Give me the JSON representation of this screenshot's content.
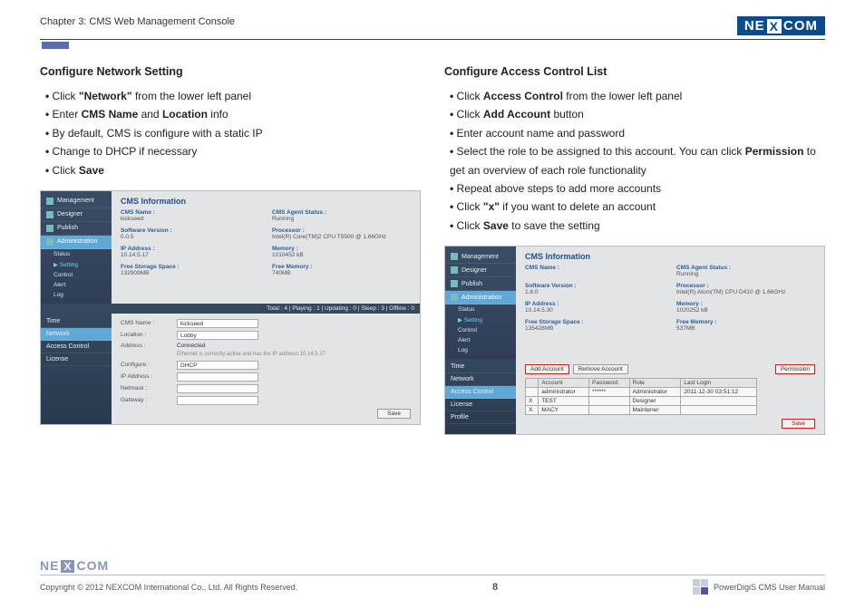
{
  "header": {
    "chapter": "Chapter 3: CMS Web Management Console",
    "logo_left": "NE",
    "logo_x": "X",
    "logo_right": "COM"
  },
  "left": {
    "title": "Configure Network Setting",
    "bullets": [
      "Click <b>\"Network\"</b> from the lower left panel",
      "Enter <b>CMS Name</b> and <b>Location</b> info",
      "By default, CMS is configure with a static IP",
      "Change to DHCP if necessary",
      "Click <b>Save</b>"
    ],
    "ss": {
      "side": [
        "Management",
        "Designer",
        "Publish",
        "Administration"
      ],
      "subs": [
        "Status",
        "▶ Setting",
        "Control",
        "Alert",
        "Log"
      ],
      "title": "CMS Information",
      "info": [
        {
          "lbl": "CMS Name :",
          "val": "kickseed"
        },
        {
          "lbl": "CMS Agent Status :",
          "val": "Running"
        },
        {
          "lbl": "Software Version :",
          "val": "0.0.5"
        },
        {
          "lbl": "Processor :",
          "val": "Intel(R) Core(TM)2 CPU T5500 @ 1.66GHz"
        },
        {
          "lbl": "IP Address :",
          "val": "10.14.5.17"
        },
        {
          "lbl": "Memory :",
          "val": "1010452 kB"
        },
        {
          "lbl": "Free Storage Space :",
          "val": "132909MB"
        },
        {
          "lbl": "Free Memory :",
          "val": "740MB"
        }
      ],
      "status": "Total : 4  |  Playing : 1  |  Updating : 0  |  Sleep : 3  |  Offline : 0",
      "lower_side": [
        "Time",
        "Network",
        "Access Control",
        "License"
      ],
      "form": {
        "cms_name_label": "CMS Name :",
        "cms_name_val": "kickseed",
        "location_label": "Location :",
        "location_val": "Lobby",
        "address_label": "Address :",
        "address_val": "Connected",
        "eth_note": "Ethernet is currently active and has the IP address 10.14.5.17",
        "configure_label": "Configure :",
        "configure_val": "DHCP",
        "ip_label": "IP Address :",
        "netmask_label": "Netmask :",
        "gateway_label": "Gateway :",
        "save": "Save"
      }
    }
  },
  "right": {
    "title": "Configure Access Control List",
    "bullets": [
      "Click <b>Access Control</b> from the lower left panel",
      "Click <b>Add Account</b> button",
      "Enter account name and password",
      "Select the role to be assigned to this account. You can click <b>Permission</b> to get an overview of each role functionality",
      "Repeat above steps to add more accounts",
      "Click <b>\"x\"</b> if you want to delete an account",
      "Click <b>Save</b> to save the setting"
    ],
    "ss": {
      "side": [
        "Management",
        "Designer",
        "Publish",
        "Administration"
      ],
      "subs": [
        "Status",
        "▶ Setting",
        "Control",
        "Alert",
        "Log"
      ],
      "title": "CMS Information",
      "info": [
        {
          "lbl": "CMS Name :",
          "val": ""
        },
        {
          "lbl": "CMS Agent Status :",
          "val": "Running"
        },
        {
          "lbl": "Software Version :",
          "val": "1.8.0"
        },
        {
          "lbl": "Processor :",
          "val": "Intel(R) Atom(TM) CPU D410 @ 1.66GHz"
        },
        {
          "lbl": "IP Address :",
          "val": "10.14.5.30"
        },
        {
          "lbl": "Memory :",
          "val": "1020252 kB"
        },
        {
          "lbl": "Free Storage Space :",
          "val": "135428MB"
        },
        {
          "lbl": "Free Memory :",
          "val": "537MB"
        }
      ],
      "lower_side": [
        "Time",
        "Network",
        "Access Control",
        "License",
        "Profile"
      ],
      "buttons": {
        "add": "Add Account",
        "remove": "Remove Account",
        "perm": "Permission"
      },
      "table": {
        "headers": [
          "",
          "Account",
          "Password",
          "Role",
          "Last Login"
        ],
        "rows": [
          [
            "",
            "administrator",
            "******",
            "Administrator",
            "2011-12-30 03:51:12"
          ],
          [
            "X",
            "TEST",
            "",
            "Designer",
            ""
          ],
          [
            "X",
            "MACY",
            "",
            "Maintener",
            ""
          ]
        ]
      },
      "save": "Save"
    }
  },
  "footer": {
    "copyright": "Copyright © 2012 NEXCOM International Co., Ltd. All Rights Reserved.",
    "page": "8",
    "manual": "PowerDigiS CMS User Manual"
  }
}
